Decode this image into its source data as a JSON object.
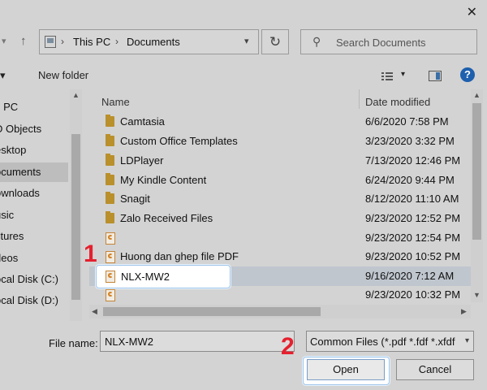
{
  "window": {
    "close_glyph": "✕"
  },
  "address_bar": {
    "segments": [
      "This PC",
      "Documents"
    ],
    "separator": "›"
  },
  "search": {
    "placeholder": "Search Documents"
  },
  "toolbar": {
    "new_folder": "New folder",
    "help_glyph": "?"
  },
  "sidebar": {
    "items": [
      {
        "label": "s PC"
      },
      {
        "label": "D Objects"
      },
      {
        "label": "esktop"
      },
      {
        "label": "ocuments",
        "selected": true
      },
      {
        "label": "ownloads"
      },
      {
        "label": "usic"
      },
      {
        "label": "ctures"
      },
      {
        "label": "deos"
      },
      {
        "label": "ocal Disk (C:)"
      },
      {
        "label": "ocal Disk (D:)"
      }
    ]
  },
  "file_list": {
    "columns": {
      "name": "Name",
      "date": "Date modified"
    },
    "rows": [
      {
        "icon": "folder-icon",
        "name": "Camtasia",
        "date": "6/6/2020 7:58 PM"
      },
      {
        "icon": "folder-icon",
        "name": "Custom Office Templates",
        "date": "3/23/2020 3:32 PM"
      },
      {
        "icon": "folder-icon",
        "name": "LDPlayer",
        "date": "7/13/2020 12:46 PM"
      },
      {
        "icon": "folder-icon",
        "name": "My Kindle Content",
        "date": "6/24/2020 9:44 PM"
      },
      {
        "icon": "folder-icon",
        "name": "Snagit",
        "date": "8/12/2020 11:10 AM"
      },
      {
        "icon": "folder-icon",
        "name": "Zalo Received Files",
        "date": "9/23/2020 12:52 PM"
      },
      {
        "icon": "pdf-icon",
        "name": "",
        "date": "9/23/2020 12:54 PM"
      },
      {
        "icon": "pdf-icon",
        "name": "Huong dan ghep file PDF",
        "date": "9/23/2020 10:52 PM"
      },
      {
        "icon": "pdf-icon",
        "name": "NLX-MW2",
        "date": "9/16/2020 7:12 AM",
        "selected": true
      },
      {
        "icon": "pdf-icon",
        "name": "",
        "date": "9/23/2020 10:32 PM"
      }
    ]
  },
  "bottom": {
    "file_name_label": "File name:",
    "file_name_value": "NLX-MW2",
    "file_type_value": "Common Files (*.pdf *.fdf *.xfdf",
    "open_label": "Open",
    "cancel_label": "Cancel"
  },
  "annotations": {
    "step1": "1",
    "step2": "2"
  },
  "colors": {
    "accent_highlight": "#9ec5ea",
    "badge": "#e5202e",
    "help": "#1e5fae"
  }
}
